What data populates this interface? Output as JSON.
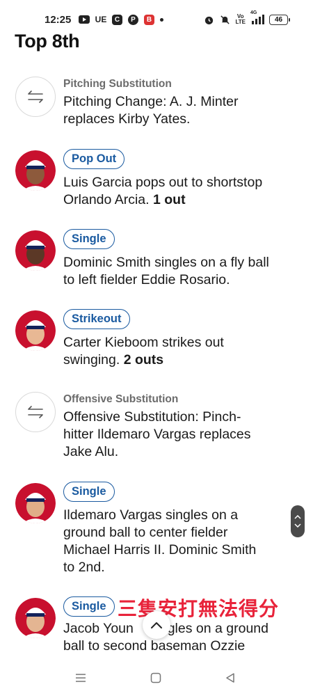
{
  "status_bar": {
    "time": "12:25",
    "left_icons": [
      "youtube-icon",
      "ue-icon",
      "c-app-icon",
      "p-app-icon",
      "b-app-icon",
      "dot-icon"
    ],
    "ue_label": "UE",
    "c_label": "C",
    "p_label": "P",
    "b_label": "B",
    "right_icons": [
      "alarm-icon",
      "mute-icon",
      "volte-icon",
      "signal-icon",
      "battery-icon"
    ],
    "volte_top": "Vo",
    "volte_bottom": "LTE",
    "network_label": "4G",
    "battery_level": "46"
  },
  "header": {
    "title": "Top 8th"
  },
  "plays": [
    {
      "type": "substitution",
      "category": "Pitching Substitution",
      "line1": "Pitching Change: A. J. Minter",
      "line2": "replaces Kirby Yates."
    },
    {
      "type": "play",
      "badge": "Pop Out",
      "line1": "Luis Garcia pops out to shortstop",
      "line2": "Orlando Arcia. ",
      "line2_bold": "1 out"
    },
    {
      "type": "play",
      "badge": "Single",
      "line1": "Dominic Smith singles on a fly ball",
      "line2": "to left fielder Eddie Rosario."
    },
    {
      "type": "play",
      "badge": "Strikeout",
      "line1": "Carter Kieboom strikes out",
      "line2": "swinging. ",
      "line2_bold": "2 outs"
    },
    {
      "type": "substitution",
      "category": "Offensive Substitution",
      "line1": "Offensive Substitution: Pinch-",
      "line2": "hitter Ildemaro Vargas replaces",
      "line3": "Jake Alu."
    },
    {
      "type": "play",
      "badge": "Single",
      "line1": "Ildemaro Vargas singles on a",
      "line2": "ground ball to center fielder",
      "line3": "Michael Harris II. Dominic Smith",
      "line4": "to 2nd."
    },
    {
      "type": "play",
      "badge": "Single",
      "line1_start": "Jacob Youn",
      "line1_end": "ngles on a ground",
      "line2": "ball to second baseman Ozzie"
    }
  ],
  "overlay_caption": "三隻安打無法得分",
  "colors": {
    "badge_blue": "#1a5aa0",
    "avatar_red": "#c8102e",
    "caption_red": "#e8233a"
  },
  "nav": {
    "icons": [
      "menu-icon",
      "home-icon",
      "back-icon"
    ]
  }
}
